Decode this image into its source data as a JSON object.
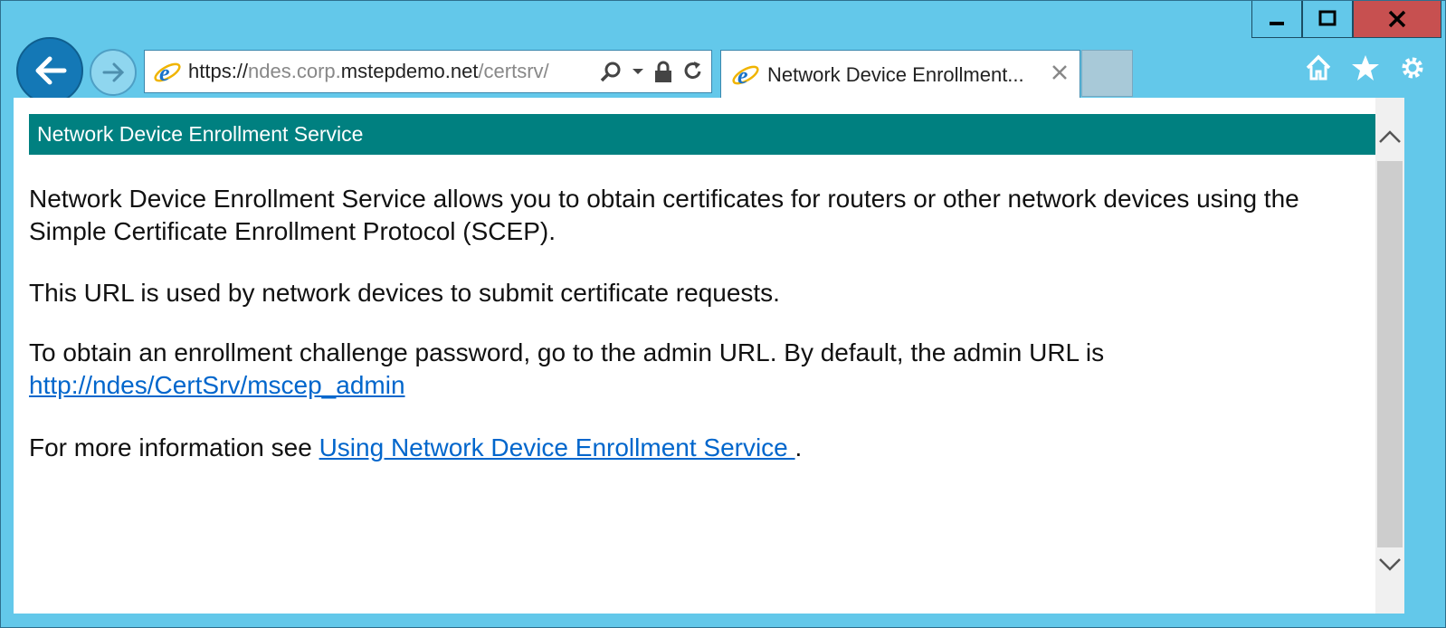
{
  "window": {
    "minimize_label": "minimize",
    "maximize_label": "maximize",
    "close_label": "close"
  },
  "addressbar": {
    "url_prefix": "https://",
    "url_host_dim": "ndes.corp.",
    "url_host_main": "mstepdemo.net",
    "url_path": "/certsrv/"
  },
  "tab": {
    "title": "Network Device Enrollment..."
  },
  "page": {
    "banner": "Network Device Enrollment Service",
    "para1": "Network Device Enrollment Service allows you to obtain certificates for routers or other network devices using the Simple Certificate Enrollment Protocol (SCEP).",
    "para2": "This URL is used by network devices to submit certificate requests.",
    "para3_text": "To obtain an enrollment challenge password, go to the admin URL. By default, the admin URL is",
    "para3_link": "http://ndes/CertSrv/mscep_admin",
    "para4_prefix": "For more information see",
    "para4_link": "Using Network Device Enrollment Service ",
    "para4_suffix": "."
  },
  "colors": {
    "chrome": "#63c8ea",
    "banner": "#008080",
    "link": "#0066cc",
    "close_button": "#c75050"
  },
  "icons": [
    "back-arrow-icon",
    "forward-arrow-icon",
    "ie-logo-icon",
    "search-icon",
    "dropdown-icon",
    "lock-icon",
    "refresh-icon",
    "home-icon",
    "favorites-star-icon",
    "settings-gear-icon",
    "close-icon",
    "scroll-up-icon",
    "scroll-down-icon"
  ]
}
